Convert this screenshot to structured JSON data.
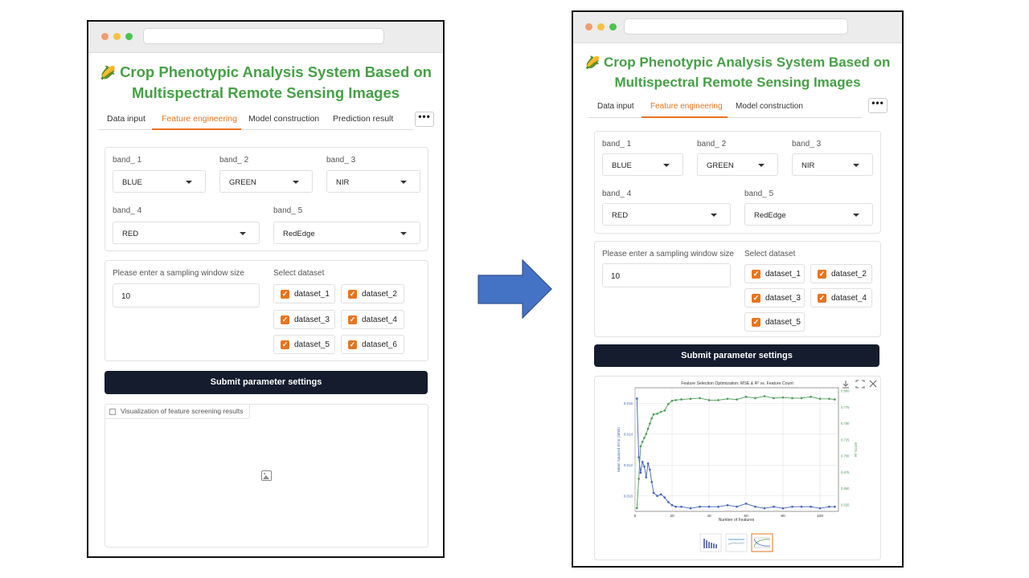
{
  "app": {
    "title_line1": "Crop Phenotypic Analysis System Based on",
    "title_line2": "Multispectral Remote Sensing Images",
    "title_icon": "corn-icon"
  },
  "left": {
    "tabs": [
      "Data input",
      "Feature engineering",
      "Model construction",
      "Prediction result"
    ],
    "active_tab": "Feature engineering",
    "more_label": "•••",
    "bands": [
      {
        "label": "band_ 1",
        "value": "BLUE"
      },
      {
        "label": "band_ 2",
        "value": "GREEN"
      },
      {
        "label": "band_ 3",
        "value": "NIR"
      },
      {
        "label": "band_ 4",
        "value": "RED"
      },
      {
        "label": "band_ 5",
        "value": "RedEdge"
      }
    ],
    "window_label": "Please enter a sampling window size",
    "window_value": "10",
    "dataset_label": "Select dataset",
    "datasets": [
      "dataset_1",
      "dataset_2",
      "dataset_3",
      "dataset_4",
      "dataset_5",
      "dataset_6"
    ],
    "submit_label": "Submit parameter settings",
    "viz_label": "Visualization of feature screening results"
  },
  "right": {
    "tabs": [
      "Data input",
      "Feature engineering",
      "Model construction"
    ],
    "active_tab": "Feature engineering",
    "more_label": "•••",
    "bands": [
      {
        "label": "band_ 1",
        "value": "BLUE"
      },
      {
        "label": "band_ 2",
        "value": "GREEN"
      },
      {
        "label": "band_ 3",
        "value": "NIR"
      },
      {
        "label": "band_ 4",
        "value": "RED"
      },
      {
        "label": "band_ 5",
        "value": "RedEdge"
      }
    ],
    "window_label": "Please enter a sampling window size",
    "window_value": "10",
    "dataset_label": "Select dataset",
    "datasets": [
      "dataset_1",
      "dataset_2",
      "dataset_3",
      "dataset_4",
      "dataset_5"
    ],
    "submit_label": "Submit parameter settings"
  },
  "chart_data": {
    "type": "line",
    "title": "Feature Selection Optimization: MSE & R² vs. Feature Count",
    "xlabel": "Number of Features",
    "ylabel_left": "Mean Squared Error (MSE)",
    "ylabel_right": "R² Score",
    "xlim": [
      0,
      110
    ],
    "ylim_left": [
      0.009,
      0.017
    ],
    "ylim_right": [
      0.615,
      0.805
    ],
    "x_ticks": [
      "0",
      "20",
      "40",
      "60",
      "80",
      "100"
    ],
    "y_left_ticks": [
      "0.010",
      "0.012",
      "0.014",
      "0.016"
    ],
    "y_right_ticks": [
      "0.625",
      "0.650",
      "0.675",
      "0.700",
      "0.725",
      "0.750",
      "0.775",
      "0.800"
    ],
    "series": [
      {
        "axis": "left",
        "color": "#3f63b5",
        "x": [
          1,
          2,
          3,
          4,
          5,
          6,
          7,
          8,
          9,
          10,
          12,
          14,
          16,
          18,
          20,
          22,
          25,
          30,
          35,
          40,
          45,
          50,
          55,
          60,
          65,
          70,
          75,
          80,
          85,
          90,
          95,
          100,
          105,
          108
        ],
        "values": [
          0.0163,
          0.0125,
          0.0115,
          0.0122,
          0.0119,
          0.0112,
          0.0121,
          0.0117,
          0.0109,
          0.0102,
          0.01,
          0.0101,
          0.0099,
          0.0096,
          0.0094,
          0.0093,
          0.0093,
          0.0092,
          0.0093,
          0.0093,
          0.0093,
          0.0094,
          0.0093,
          0.0095,
          0.0093,
          0.0092,
          0.0093,
          0.0092,
          0.0093,
          0.0093,
          0.0093,
          0.0092,
          0.0093,
          0.0093
        ]
      },
      {
        "axis": "right",
        "color": "#4c9a55",
        "x": [
          1,
          2,
          3,
          4,
          5,
          6,
          7,
          8,
          9,
          10,
          12,
          14,
          16,
          18,
          20,
          22,
          25,
          30,
          35,
          40,
          45,
          50,
          55,
          60,
          65,
          70,
          75,
          80,
          85,
          90,
          95,
          100,
          105,
          108
        ],
        "values": [
          0.62,
          0.665,
          0.715,
          0.722,
          0.728,
          0.734,
          0.742,
          0.75,
          0.758,
          0.764,
          0.765,
          0.768,
          0.77,
          0.78,
          0.785,
          0.786,
          0.787,
          0.788,
          0.789,
          0.786,
          0.786,
          0.788,
          0.787,
          0.791,
          0.789,
          0.792,
          0.789,
          0.79,
          0.789,
          0.789,
          0.791,
          0.788,
          0.788,
          0.787
        ]
      }
    ]
  }
}
